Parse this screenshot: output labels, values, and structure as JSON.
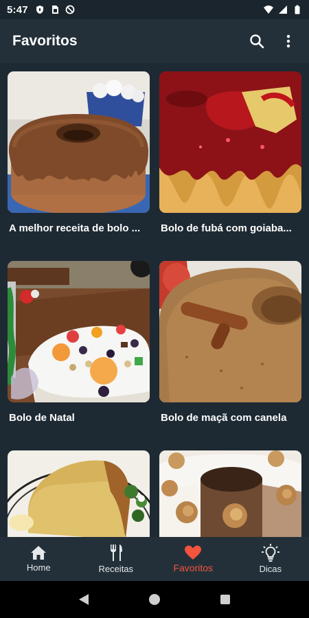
{
  "status_bar": {
    "time": "5:47",
    "left_icons": [
      "shield-icon",
      "sim-card-icon",
      "no-sync-icon"
    ],
    "right_icons": [
      "wifi-icon",
      "signal-icon",
      "battery-icon"
    ]
  },
  "app_bar": {
    "title": "Favoritos",
    "actions": [
      "search-icon",
      "more-vert-icon"
    ]
  },
  "recipes": [
    {
      "title": "A melhor receita de bolo ...",
      "image": "chocolate-glazed-bundt-cake"
    },
    {
      "title": "Bolo de fubá com goiaba...",
      "image": "guava-glazed-cornmeal-cake"
    },
    {
      "title": "Bolo de Natal",
      "image": "christmas-cake-with-dried-fruits"
    },
    {
      "title": "Bolo de maçã com canela",
      "image": "apple-cinnamon-cake"
    },
    {
      "title": "",
      "image": "cake-slice-on-plate"
    },
    {
      "title": "",
      "image": "walnut-frosted-cake"
    }
  ],
  "bottom_nav": {
    "items": [
      {
        "label": "Home",
        "icon": "home-icon",
        "active": false
      },
      {
        "label": "Receitas",
        "icon": "cutlery-icon",
        "active": false
      },
      {
        "label": "Favoritos",
        "icon": "heart-icon",
        "active": true
      },
      {
        "label": "Dicas",
        "icon": "lightbulb-icon",
        "active": false
      }
    ]
  },
  "colors": {
    "background": "#1e2a33",
    "app_bar": "#233039",
    "accent": "#f2543d",
    "text": "#ffffff"
  }
}
